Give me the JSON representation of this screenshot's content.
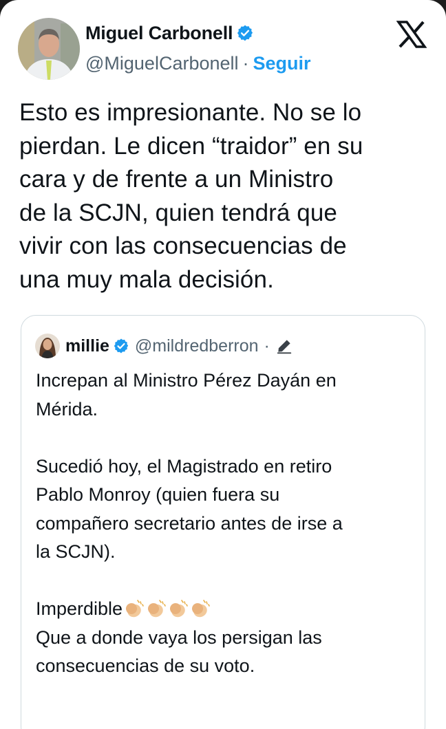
{
  "tweet": {
    "author": {
      "display_name": "Miguel Carbonell",
      "handle": "@MiguelCarbonell",
      "separator": "·",
      "follow_label": "Seguir",
      "verified": true
    },
    "platform_icon": "x-logo-icon",
    "text": "Esto es impresionante. No se lo\npierdan. Le dicen “traidor” en su\ncara y de frente a un Ministro\nde la SCJN, quien tendrá que\nvivir con las consecuencias de\nuna muy mala decisión."
  },
  "quoted_tweet": {
    "author": {
      "display_name": "millie",
      "handle": "@mildredberron",
      "separator": "·",
      "verified": true
    },
    "edited_icon": "pencil-icon",
    "text_part1": "Increpan al Ministro Pérez Dayán en\nMérida.\n\nSucedió hoy, el Magistrado en retiro\nPablo Monroy (quien fuera su\ncompañero secretario antes de irse a\nla SCJN).\n\nImperdible",
    "emoji_icons": [
      "clapping-hands-icon",
      "clapping-hands-icon",
      "clapping-hands-icon",
      "clapping-hands-icon"
    ],
    "text_part2": "\nQue a donde vaya los persigan las\nconsecuencias de su voto."
  },
  "colors": {
    "background": "#ffffff",
    "text": "#0f1419",
    "secondary": "#536471",
    "accent": "#1d9bf0",
    "border": "#cfd9de"
  }
}
